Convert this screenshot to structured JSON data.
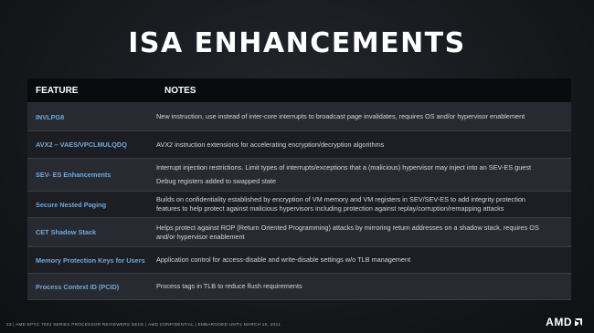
{
  "title": "ISA ENHANCEMENTS",
  "table": {
    "headers": {
      "feature": "FEATURE",
      "notes": "NOTES"
    },
    "rows": [
      {
        "feature": "INVLPG8",
        "notes": [
          "New instruction, use instead of inter-core interrupts to broadcast page invalidates, requires OS and/or hypervisor enablement"
        ]
      },
      {
        "feature": "AVX2 – VAES/VPCLMULQDQ",
        "notes": [
          "AVX2 instruction extensions for accelerating encryption/decryption algorithms"
        ]
      },
      {
        "feature": "SEV- ES Enhancements",
        "notes": [
          "Interrupt injection restrictions. Limit types of interrupts/exceptions that a (malicious) hypervisor may inject into an SEV-ES guest",
          "Debug registers added to swapped state"
        ]
      },
      {
        "feature": "Secure Nested Paging",
        "notes": [
          "Builds on confidentiality established by encryption of VM memory and VM registers in SEV/SEV-ES to add integrity protection",
          "features to help protect against malicious hypervisors including protection against replay/corruption/remapping attacks"
        ]
      },
      {
        "feature": "CET Shadow Stack",
        "notes": [
          "Helps protect against ROP (Return Oriented Programming) attacks by mirroring return addresses on a shadow stack, requires OS",
          "and/or hypervisor enablement"
        ]
      },
      {
        "feature": "Memory Protection Keys for Users",
        "notes": [
          "Application control for access-disable and write-disable settings w/o TLB management"
        ]
      },
      {
        "feature": "Process Context ID (PCID)",
        "notes": [
          "Process tags in TLB to reduce flush requirements"
        ]
      }
    ]
  },
  "footer": "23  |  AMD EPYC 7003 SERIES PROCESSOR REVIEWERS DECK  |  AMD CONFIDENTIAL  |  EMBARGOED UNTIL MARCH 15, 2021",
  "logo": "AMD"
}
